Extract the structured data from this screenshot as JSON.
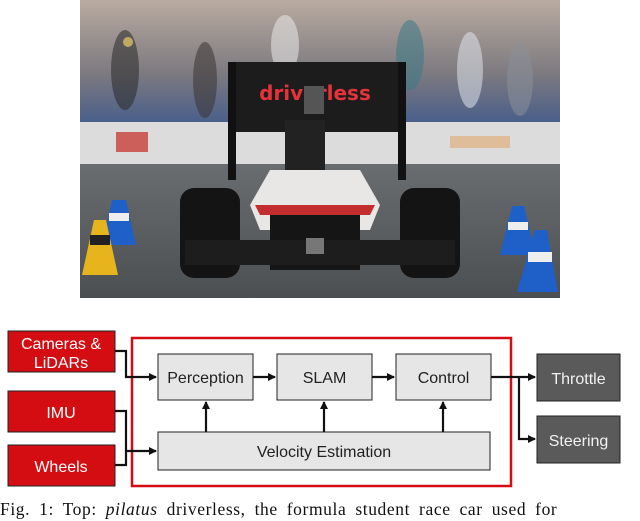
{
  "photo": {
    "description": "pilatus driverless formula student race car on track between traffic cones",
    "wing_text": "driverless",
    "colors": {
      "wing_text": "#e8323a",
      "cone_blue": "#1f5fc8",
      "cone_yellow": "#e6b41c",
      "asphalt": "#5a5d60"
    }
  },
  "diagram": {
    "colors": {
      "input_fill": "#d40d12",
      "frame": "#d40d12",
      "block_fill": "#e6e6e6",
      "output_fill": "#5a5a5a",
      "edge": "#111111"
    },
    "inputs": [
      {
        "id": "cameras",
        "lines": [
          "Cameras &",
          "LiDARs"
        ]
      },
      {
        "id": "imu",
        "lines": [
          "IMU"
        ]
      },
      {
        "id": "wheels",
        "lines": [
          "Wheels"
        ]
      }
    ],
    "blocks": [
      {
        "id": "perception",
        "label": "Perception"
      },
      {
        "id": "slam",
        "label": "SLAM"
      },
      {
        "id": "control",
        "label": "Control"
      },
      {
        "id": "velocity",
        "label": "Velocity Estimation"
      }
    ],
    "outputs": [
      {
        "id": "throttle",
        "label": "Throttle"
      },
      {
        "id": "steering",
        "label": "Steering"
      }
    ],
    "edges": [
      {
        "from": "cameras",
        "to": "perception"
      },
      {
        "from": "imu",
        "to": "velocity"
      },
      {
        "from": "wheels",
        "to": "velocity"
      },
      {
        "from": "perception",
        "to": "slam"
      },
      {
        "from": "slam",
        "to": "control"
      },
      {
        "from": "velocity",
        "to": "perception"
      },
      {
        "from": "velocity",
        "to": "slam"
      },
      {
        "from": "velocity",
        "to": "control"
      },
      {
        "from": "control",
        "to": "throttle"
      },
      {
        "from": "control",
        "to": "steering"
      }
    ]
  },
  "caption": {
    "prefix": "Fig. 1: Top: ",
    "italic": "pilatus",
    "rest": " driverless, the formula student race car used for"
  }
}
